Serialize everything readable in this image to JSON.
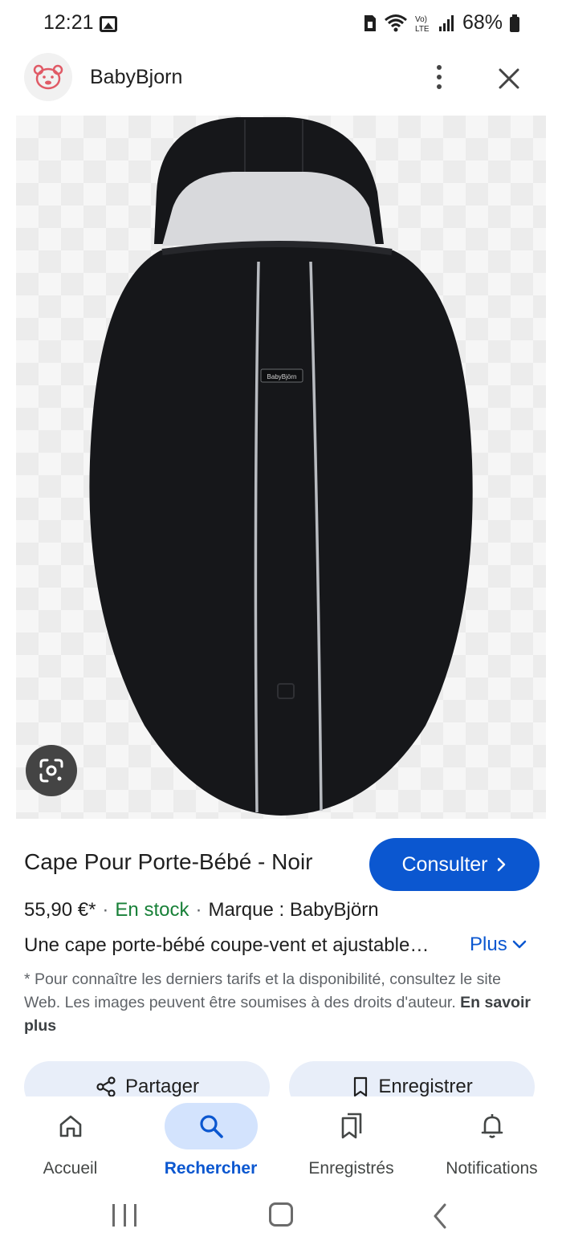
{
  "status_bar": {
    "time": "12:21",
    "battery": "68%",
    "icons": [
      "image-notification-icon",
      "sim-icon",
      "wifi-icon",
      "volte-lte-icon",
      "signal-icon",
      "battery-icon"
    ]
  },
  "header": {
    "site_name": "BabyBjorn",
    "logo_icon": "babybjorn-bear-logo",
    "more_icon": "more-vertical-icon",
    "close_icon": "close-icon"
  },
  "product": {
    "image_description_icon": "product-image",
    "image_brand_label": "BabyBjörn",
    "lens_icon": "google-lens-icon",
    "title": "Cape Pour Porte-Bébé - Noir",
    "consult_label": "Consulter",
    "price": "55,90 €*",
    "stock": "En stock",
    "brand": "Marque : BabyBjörn",
    "description": "Une cape porte-bébé coupe-vent et ajustable…",
    "more_label": "Plus",
    "disclaimer": "* Pour connaître les derniers tarifs et la disponibilité, consultez le site Web. Les images peuvent être soumises à des droits d'auteur.",
    "learn_more": "En savoir plus",
    "share_label": "Partager",
    "save_label": "Enregistrer"
  },
  "bottom_nav": {
    "items": [
      {
        "label": "Accueil",
        "icon": "home-icon",
        "active": false
      },
      {
        "label": "Rechercher",
        "icon": "search-icon",
        "active": true
      },
      {
        "label": "Enregistrés",
        "icon": "bookmarks-icon",
        "active": false
      },
      {
        "label": "Notifications",
        "icon": "bell-icon",
        "active": false
      }
    ]
  },
  "colors": {
    "accent": "#0b57d0",
    "stock_green": "#188038",
    "active_pill": "#d3e3fd",
    "action_button_bg": "#e8eef9"
  }
}
